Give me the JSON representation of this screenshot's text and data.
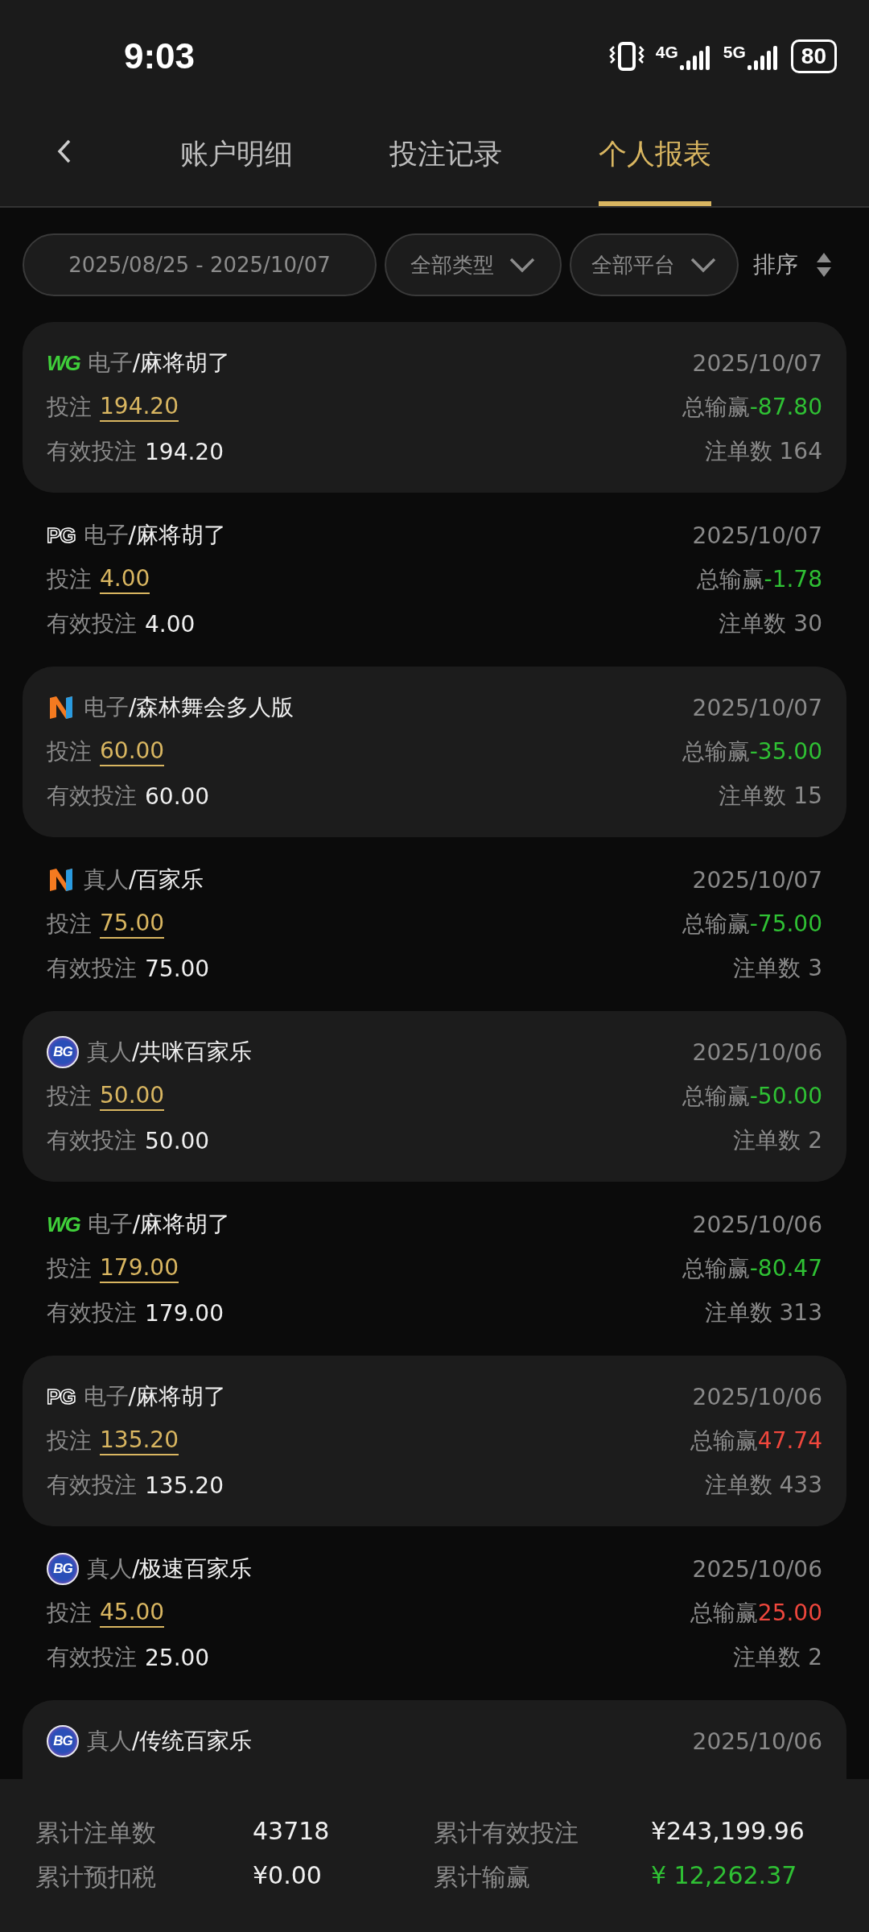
{
  "status_bar": {
    "time": "9:03",
    "networks": [
      "4G",
      "5G"
    ],
    "battery": "80"
  },
  "tabs": [
    {
      "label": "账户明细",
      "selected": false
    },
    {
      "label": "投注记录",
      "selected": false
    },
    {
      "label": "个人报表",
      "selected": true
    }
  ],
  "filters": {
    "date_range": "2025/08/25 - 2025/10/07",
    "dropdowns": [
      "全部类型",
      "全部平台"
    ],
    "sort": "排序"
  },
  "records": [
    {
      "shaded": true,
      "logo": {
        "kind": "wg",
        "text": "WG"
      },
      "category": "电子",
      "game": "/麻将胡了",
      "date": "2025/10/07",
      "bet_label": "投注",
      "bet": "194.20",
      "net_label": "总输赢",
      "net": "-87.80",
      "color": "#2fc134",
      "valid_label": "有效投注",
      "valid": "194.20",
      "count": "注单数 164"
    },
    {
      "shaded": false,
      "logo": {
        "kind": "pg",
        "text": "PG"
      },
      "category": "电子",
      "game": "/麻将胡了",
      "date": "2025/10/07",
      "bet_label": "投注",
      "bet": "4.00",
      "net_label": "总输赢",
      "net": "-1.78",
      "color": "#2fc134",
      "valid_label": "有效投注",
      "valid": "4.00",
      "count": "注单数 30"
    },
    {
      "shaded": true,
      "logo": {
        "kind": "n"
      },
      "category": "电子",
      "game": "/森林舞会多人版",
      "date": "2025/10/07",
      "bet_label": "投注",
      "bet": "60.00",
      "net_label": "总输赢",
      "net": "-35.00",
      "color": "#2fc134",
      "valid_label": "有效投注",
      "valid": "60.00",
      "count": "注单数 15"
    },
    {
      "shaded": false,
      "logo": {
        "kind": "n"
      },
      "category": "真人",
      "game": "/百家乐",
      "date": "2025/10/07",
      "bet_label": "投注",
      "bet": "75.00",
      "net_label": "总输赢",
      "net": "-75.00",
      "color": "#2fc134",
      "valid_label": "有效投注",
      "valid": "75.00",
      "count": "注单数 3"
    },
    {
      "shaded": true,
      "logo": {
        "kind": "bg",
        "text": "BG"
      },
      "category": "真人",
      "game": "/共咪百家乐",
      "date": "2025/10/06",
      "bet_label": "投注",
      "bet": "50.00",
      "net_label": "总输赢",
      "net": "-50.00",
      "color": "#2fc134",
      "valid_label": "有效投注",
      "valid": "50.00",
      "count": "注单数 2"
    },
    {
      "shaded": false,
      "logo": {
        "kind": "wg",
        "text": "WG"
      },
      "category": "电子",
      "game": "/麻将胡了",
      "date": "2025/10/06",
      "bet_label": "投注",
      "bet": "179.00",
      "net_label": "总输赢",
      "net": "-80.47",
      "color": "#2fc134",
      "valid_label": "有效投注",
      "valid": "179.00",
      "count": "注单数 313"
    },
    {
      "shaded": true,
      "logo": {
        "kind": "pg",
        "text": "PG"
      },
      "category": "电子",
      "game": "/麻将胡了",
      "date": "2025/10/06",
      "bet_label": "投注",
      "bet": "135.20",
      "net_label": "总输赢",
      "net": "47.74",
      "color": "#f0473d",
      "valid_label": "有效投注",
      "valid": "135.20",
      "count": "注单数 433"
    },
    {
      "shaded": false,
      "logo": {
        "kind": "bg",
        "text": "BG"
      },
      "category": "真人",
      "game": "/极速百家乐",
      "date": "2025/10/06",
      "bet_label": "投注",
      "bet": "45.00",
      "net_label": "总输赢",
      "net": "25.00",
      "color": "#f0473d",
      "valid_label": "有效投注",
      "valid": "25.00",
      "count": "注单数 2"
    },
    {
      "shaded": true,
      "logo": {
        "kind": "bg",
        "text": "BG"
      },
      "category": "真人",
      "game": "/传统百家乐",
      "date": "2025/10/06"
    }
  ],
  "summary": [
    {
      "label": "累计注单数",
      "value": "43718"
    },
    {
      "label": "累计有效投注",
      "value": "¥243,199.96"
    },
    {
      "label": "累计预扣税",
      "value": "¥0.00"
    },
    {
      "label": "累计输赢",
      "value": "¥ 12,262.37",
      "color": "#2fc134"
    }
  ]
}
